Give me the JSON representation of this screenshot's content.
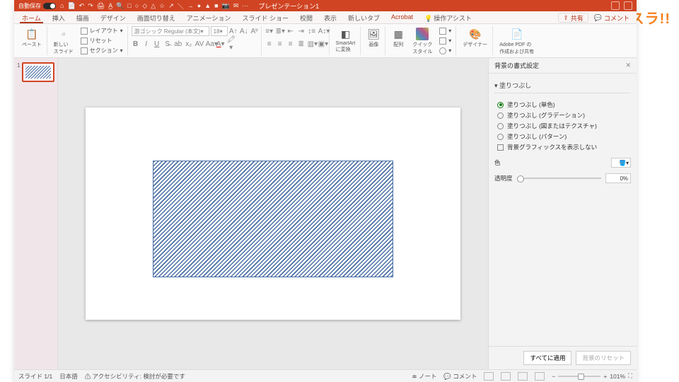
{
  "watermark": "シースラ!!",
  "titlebar": {
    "autosave_label": "自動保存",
    "autosave_state": "オフ",
    "title": "プレゼンテーション1",
    "qat_icons": [
      "⌂",
      "📄",
      "↶",
      "↷",
      "🖨",
      "A̲",
      "🔍",
      "□",
      "○",
      "◇",
      "△",
      "☆",
      "↗",
      "＼",
      "→",
      "●",
      "▲",
      "■",
      "📷",
      "✉",
      "⋯"
    ]
  },
  "tabs": {
    "items": [
      "ホーム",
      "挿入",
      "描画",
      "デザイン",
      "画面切り替え",
      "アニメーション",
      "スライド ショー",
      "校閲",
      "表示",
      "新しいタブ",
      "Acrobat"
    ],
    "assist": "操作アシスト",
    "share": "共有",
    "comment": "コメント"
  },
  "ribbon": {
    "paste": "ペースト",
    "newslide": "新しい\nスライド",
    "layout": "レイアウト",
    "reset": "リセット",
    "section": "セクション",
    "font_name": "游ゴシック Regular (本文)",
    "font_size": "18",
    "smartart": "SmartArt\nに変換",
    "image": "画像",
    "arrange": "配列",
    "quickstyle": "クイック\nスタイル",
    "designer": "デザイナー",
    "adobe": "Adobe PDF の\n作成および共有"
  },
  "thumbs": {
    "num": "1"
  },
  "panel": {
    "title": "背景の書式設定",
    "section": "塗りつぶし",
    "opts": {
      "solid": "塗りつぶし (単色)",
      "grad": "塗りつぶし (グラデーション)",
      "pic": "塗りつぶし (図またはテクスチャ)",
      "pat": "塗りつぶし (パターン)",
      "hidebg": "背景グラフィックスを表示しない"
    },
    "color_label": "色",
    "trans_label": "透明度",
    "trans_value": "0%",
    "apply_all": "すべてに適用",
    "reset_bg": "背景のリセット"
  },
  "status": {
    "slide": "スライド 1/1",
    "lang": "日本語",
    "a11y": "アクセシビリティ: 検討が必要です",
    "notes": "ノート",
    "comments": "コメント",
    "zoom": "101%"
  }
}
